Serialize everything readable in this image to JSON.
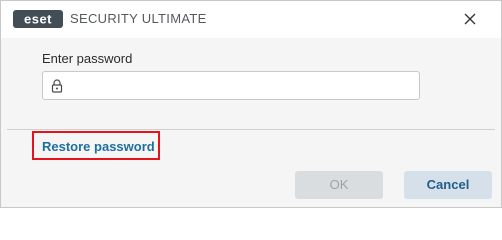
{
  "window": {
    "brand_logo_text": "eset",
    "title": "SECURITY ULTIMATE"
  },
  "icons": {
    "logo": "eset-logo",
    "close": "close-icon",
    "lock": "lock-icon"
  },
  "form": {
    "password_label": "Enter password",
    "password_value": "",
    "password_placeholder": ""
  },
  "footer": {
    "restore_link_label": "Restore password",
    "ok_label": "OK",
    "ok_enabled": false,
    "cancel_label": "Cancel"
  },
  "colors": {
    "link": "#1f6f9e",
    "highlight_border": "#e3141b",
    "cancel_text": "#1f5f8b",
    "ok_disabled_bg": "#d9dde0"
  }
}
